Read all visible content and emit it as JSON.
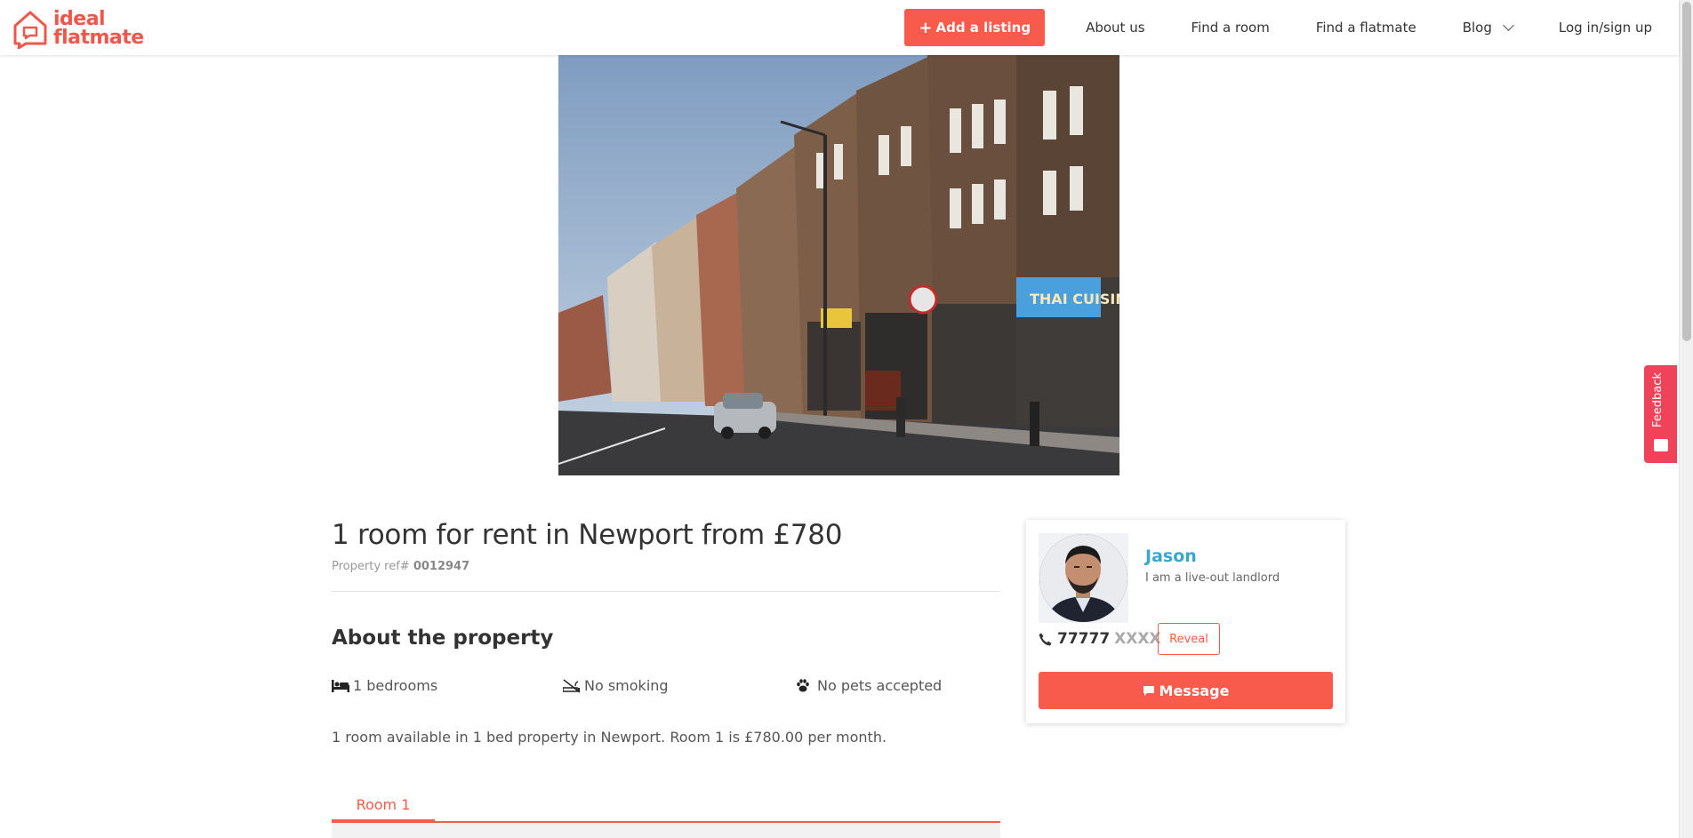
{
  "brand": {
    "logo_line1": "ideal",
    "logo_line2": "flatmate",
    "accent_color": "#f85a4b",
    "link_color": "#3aa6ce"
  },
  "nav": {
    "add_listing": "Add a listing",
    "about_us": "About us",
    "find_room": "Find a room",
    "find_flatmate": "Find a flatmate",
    "blog": "Blog",
    "login": "Log in/sign up"
  },
  "listing": {
    "title": "1 room for rent in Newport from £780",
    "ref_label": "Property ref#",
    "ref_value": "0012947",
    "about_heading": "About the property",
    "features": [
      {
        "icon": "bed-icon",
        "label": "1 bedrooms"
      },
      {
        "icon": "no-smoking-icon",
        "label": "No smoking"
      },
      {
        "icon": "paw-icon",
        "label": "No pets accepted"
      }
    ],
    "description": "1 room available in 1 bed property in Newport. Room 1 is £780.00 per month.",
    "tabs": [
      {
        "label": "Room 1",
        "active": true
      }
    ]
  },
  "contact": {
    "name": "Jason",
    "role": "I am a live-out landlord",
    "phone_visible": "77777",
    "phone_masked": "XXXX",
    "reveal_label": "Reveal",
    "message_label": "Message"
  },
  "feedback": {
    "label": "Feedback"
  }
}
